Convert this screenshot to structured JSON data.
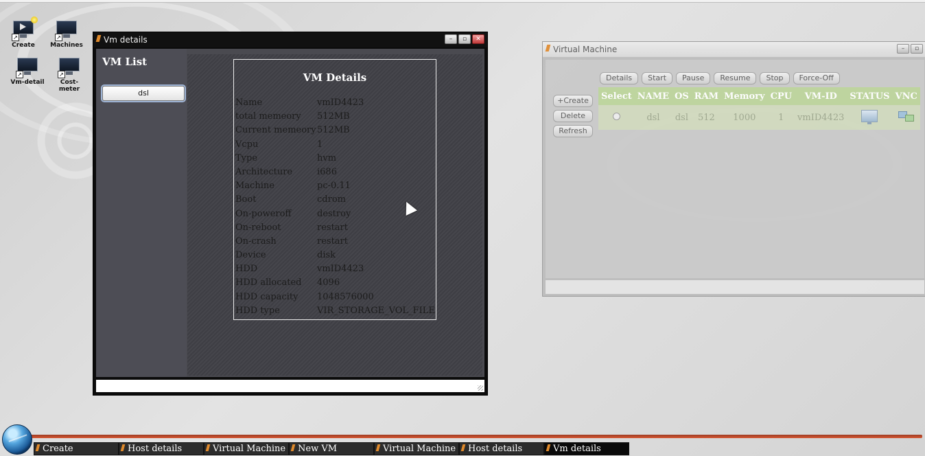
{
  "desktop": {
    "icons": [
      {
        "label": "Create",
        "icon": "create-vm-icon"
      },
      {
        "label": "Machines",
        "icon": "machines-icon"
      },
      {
        "label": "Vm-detail",
        "icon": "vm-detail-icon"
      },
      {
        "label": "Cost-meter",
        "icon": "cost-meter-icon"
      }
    ]
  },
  "vm_details_window": {
    "title": "Vm details",
    "list_title": "VM List",
    "list_items": [
      "dsl"
    ],
    "details_title": "VM Details",
    "details": [
      {
        "key": "Name",
        "value": "vmID4423"
      },
      {
        "key": "total memeory",
        "value": "512MB"
      },
      {
        "key": "Current memeory",
        "value": "512MB"
      },
      {
        "key": "Vcpu",
        "value": "1"
      },
      {
        "key": "Type",
        "value": "hvm"
      },
      {
        "key": "Architecture",
        "value": "i686"
      },
      {
        "key": "Machine",
        "value": "pc-0.11"
      },
      {
        "key": "Boot",
        "value": "cdrom"
      },
      {
        "key": "On-poweroff",
        "value": "destroy"
      },
      {
        "key": "On-reboot",
        "value": "restart"
      },
      {
        "key": "On-crash",
        "value": "restart"
      },
      {
        "key": "Device",
        "value": "disk"
      },
      {
        "key": "HDD",
        "value": "vmID4423"
      },
      {
        "key": "HDD allocated",
        "value": "4096"
      },
      {
        "key": "HDD capacity",
        "value": "1048576000"
      },
      {
        "key": "HDD type",
        "value": "VIR_STORAGE_VOL_FILE"
      }
    ]
  },
  "virtual_machine_window": {
    "title": "Virtual Machine",
    "actions": [
      "Details",
      "Start",
      "Pause",
      "Resume",
      "Stop",
      "Force-Off"
    ],
    "side_actions": [
      "+Create",
      "Delete",
      "Refresh"
    ],
    "columns": [
      "Select",
      "NAME",
      "OS",
      "RAM",
      "Memory",
      "CPU",
      "VM-ID",
      "STATUS",
      "VNC"
    ],
    "rows": [
      {
        "name": "dsl",
        "os": "dsl",
        "ram": "512",
        "memory": "1000",
        "cpu": "1",
        "vm_id": "vmID4423",
        "status_icon": "monitor-icon",
        "vnc_icon": "vnc-icon"
      }
    ]
  },
  "taskbar": {
    "items": [
      "Create",
      "Host details",
      "Virtual Machine",
      "New VM",
      "Virtual Machine",
      "Host details",
      "Vm details"
    ],
    "active_index": 6
  },
  "colors": {
    "table_header": "#bcd49a",
    "taskbar_accent": "#d85a35",
    "window_dark": "#0b0b0b"
  }
}
